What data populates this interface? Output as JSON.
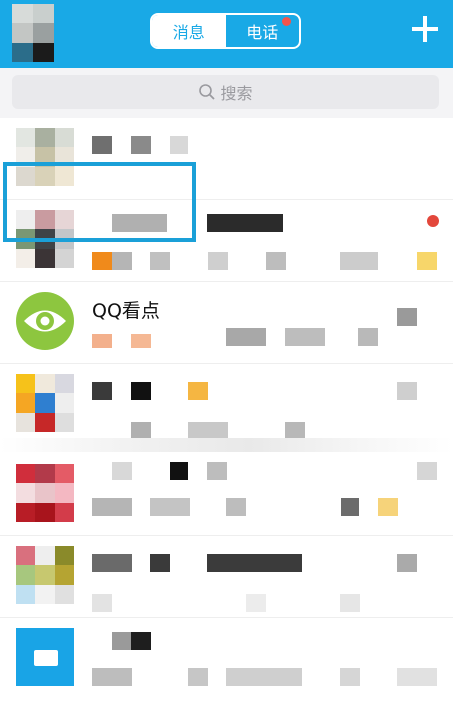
{
  "header": {
    "tabs": [
      {
        "label": "消息",
        "active": true
      },
      {
        "label": "电话",
        "active": false,
        "has_badge": true
      }
    ],
    "add_icon": "plus-icon"
  },
  "search": {
    "placeholder": "搜索",
    "icon": "search-icon"
  },
  "chats": [
    {
      "name": "",
      "blurred": true
    },
    {
      "name": "",
      "blurred": true
    },
    {
      "name": "QQ看点",
      "blurred": false,
      "highlighted": true,
      "unread": true,
      "icon": "eye-icon"
    },
    {
      "name": "",
      "blurred": true
    },
    {
      "name": "",
      "blurred": true
    },
    {
      "name": "",
      "blurred": true
    },
    {
      "name": "",
      "blurred": true
    }
  ],
  "colors": {
    "header": "#19a9e6",
    "accent": "#1aa0d8",
    "qq_kandian": "#8dc63f",
    "badge": "#f2544b"
  }
}
